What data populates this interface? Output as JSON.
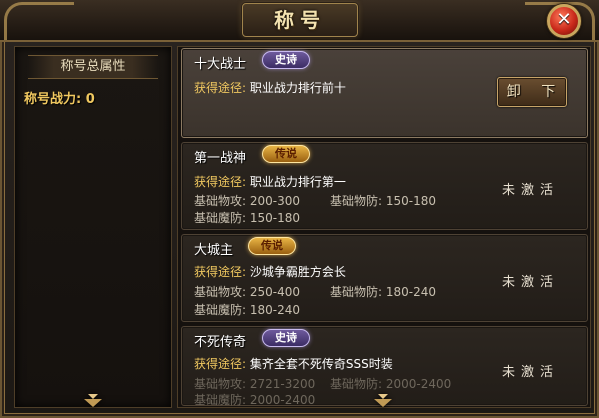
{
  "window": {
    "title": "称号",
    "close_glyph": "✕"
  },
  "summary": {
    "heading": "称号总属性",
    "power_label": "称号战力:",
    "power_value": "0"
  },
  "rarity": {
    "epic": "史诗",
    "legend": "传说"
  },
  "titles": [
    {
      "name": "十大战士",
      "rarity": "史诗",
      "source_label": "获得途径:",
      "source": "职业战力排行前十",
      "action": "卸 下",
      "selected": true
    },
    {
      "name": "第一战神",
      "rarity": "传说",
      "source_label": "获得途径:",
      "source": "职业战力排行第一",
      "stats": [
        {
          "label": "基础物攻:",
          "value": "200-300"
        },
        {
          "label": "基础物防:",
          "value": "150-180"
        },
        {
          "label": "基础魔防:",
          "value": "150-180"
        }
      ],
      "status": "未激活"
    },
    {
      "name": "大城主",
      "rarity": "传说",
      "source_label": "获得途径:",
      "source": "沙城争霸胜方会长",
      "stats": [
        {
          "label": "基础物攻:",
          "value": "250-400"
        },
        {
          "label": "基础物防:",
          "value": "180-240"
        },
        {
          "label": "基础魔防:",
          "value": "180-240"
        }
      ],
      "status": "未激活"
    },
    {
      "name": "不死传奇",
      "rarity": "史诗",
      "source_label": "获得途径:",
      "source": "集齐全套不死传奇SSS时装",
      "stats": [
        {
          "label": "基础物攻:",
          "value": "2721-3200"
        },
        {
          "label": "基础物防:",
          "value": "2000-2400"
        },
        {
          "label": "基础魔防:",
          "value": "2000-2400"
        }
      ],
      "status": "未激活"
    }
  ],
  "colors": {
    "gold_text": "#f0c860",
    "epic_badge": "#6e5a9c",
    "legend_badge": "#e8b444",
    "close_red": "#c8281a"
  }
}
